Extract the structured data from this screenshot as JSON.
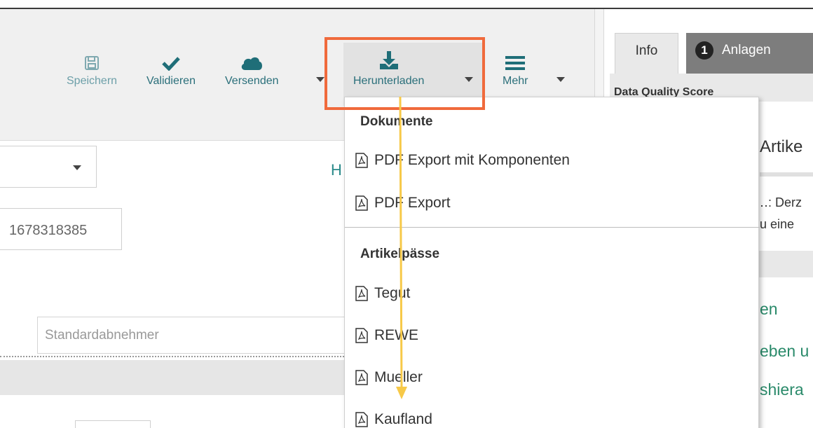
{
  "toolbar": {
    "save_label": "Speichern",
    "validate_label": "Validieren",
    "send_label": "Versenden",
    "download_label": "Herunterladen",
    "more_label": "Mehr"
  },
  "right_panel": {
    "tab_info": "Info",
    "tab_attachments_count": "1",
    "tab_attachments": "Anlagen",
    "bar_text": "Data Quality Score",
    "artikel_text": "Artike",
    "line1": "‥: Derz",
    "line2": "u eine",
    "green1": "en",
    "green2": "eben u",
    "green3": "shiera"
  },
  "form": {
    "id_value": "1678318385",
    "std_placeholder": "Standardabnehmer",
    "h_letter": "H"
  },
  "dropdown": {
    "section_documents": "Dokumente",
    "items_documents": [
      "PDF Export mit Komponenten",
      "PDF Export"
    ],
    "section_passes": "Artikelpässe",
    "items_passes": [
      "Tegut",
      "REWE",
      "Mueller",
      "Kaufland"
    ]
  },
  "colors": {
    "accent": "#2a6f7a",
    "highlight": "#f06a3c",
    "arrow": "#f7c948"
  }
}
